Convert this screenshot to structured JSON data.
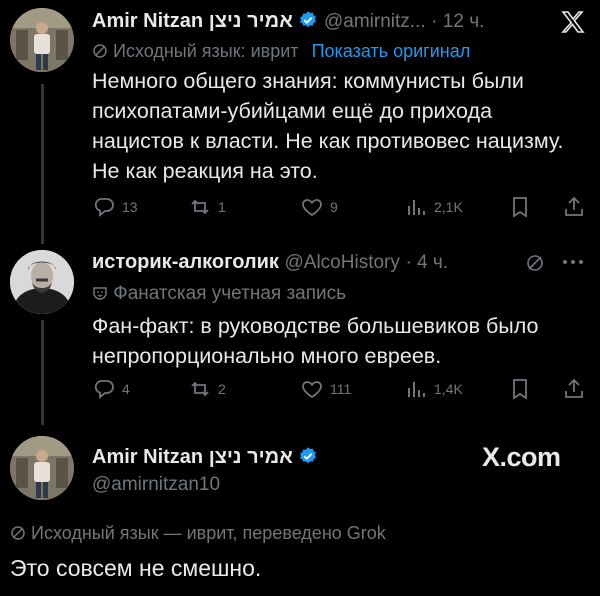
{
  "tweet1": {
    "author": "Amir Nitzan אמיר ניצן",
    "handle_time": "@amirnitz...",
    "time": "· 12 ч.",
    "translation_note": "Исходный язык: иврит",
    "show_original": "Показать оригинал",
    "text": "Немного общего знания: коммунисты были психопатами-убийцами ещё до прихода нацистов к власти. Не как противовес нацизму. Не как реакция на это.",
    "replies": "13",
    "reposts": "1",
    "likes": "9",
    "views": "2,1K"
  },
  "tweet2": {
    "author": "историк-алкоголик",
    "handle": "@AlcoHistory",
    "time": "· 4 ч.",
    "label": "Фанатская учетная запись",
    "text": "Фан-факт: в руководстве большевиков было непропорционально много евреев.",
    "replies": "4",
    "reposts": "2",
    "likes": "111",
    "views": "1,4K"
  },
  "tweet3": {
    "author": "Amir Nitzan אמיר ניצן",
    "handle": "@amirnitzan10",
    "brand": "X.com",
    "translation_note": "Исходный язык — иврит, переведено Grok",
    "text": "Это совсем не смешно."
  }
}
